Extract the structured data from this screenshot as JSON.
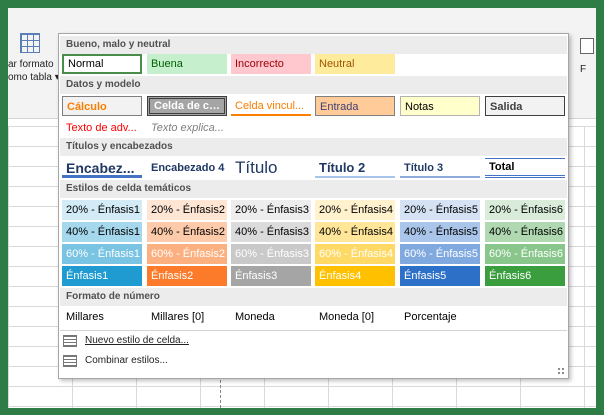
{
  "ribbon": {
    "format_table_line1": "ar formato",
    "format_table_line2": "omo tabla",
    "right_label": "F"
  },
  "sections": {
    "good_bad": "Bueno, malo y neutral",
    "data_model": "Datos y modelo",
    "titles": "Títulos y encabezados",
    "themed": "Estilos de celda temáticos",
    "number": "Formato de número"
  },
  "good_bad": [
    "Normal",
    "Buena",
    "Incorrecto",
    "Neutral"
  ],
  "data_model_row1": [
    "Cálculo",
    "Celda de co...",
    "Celda vincul...",
    "Entrada",
    "Notas",
    "Salida"
  ],
  "data_model_row2": [
    "Texto de adv...",
    "Texto explica..."
  ],
  "titles": [
    "Encabez...",
    "Encabezado 4",
    "Título",
    "Título 2",
    "Título 3",
    "Total"
  ],
  "themed_20": [
    "20% - Énfasis1",
    "20% - Énfasis2",
    "20% - Énfasis3",
    "20% - Énfasis4",
    "20% - Énfasis5",
    "20% - Énfasis6"
  ],
  "themed_40": [
    "40% - Énfasis1",
    "40% - Énfasis2",
    "40% - Énfasis3",
    "40% - Énfasis4",
    "40% - Énfasis5",
    "40% - Énfasis6"
  ],
  "themed_60": [
    "60% - Énfasis1",
    "60% - Énfasis2",
    "60% - Énfasis3",
    "60% - Énfasis4",
    "60% - Énfasis5",
    "60% - Énfasis6"
  ],
  "themed_100": [
    "Énfasis1",
    "Énfasis2",
    "Énfasis3",
    "Énfasis4",
    "Énfasis5",
    "Énfasis6"
  ],
  "number_formats": [
    "Millares",
    "Millares [0]",
    "Moneda",
    "Moneda [0]",
    "Porcentaje"
  ],
  "actions": {
    "new_style": "Nuevo estilo de celda...",
    "merge_styles": "Combinar estilos..."
  },
  "colors": {
    "accent1": "#1f9bd1",
    "accent2": "#fb7b2b",
    "accent3": "#a5a5a5",
    "accent4": "#ffc000",
    "accent5": "#2d70c7",
    "accent6": "#3a9e3e"
  }
}
